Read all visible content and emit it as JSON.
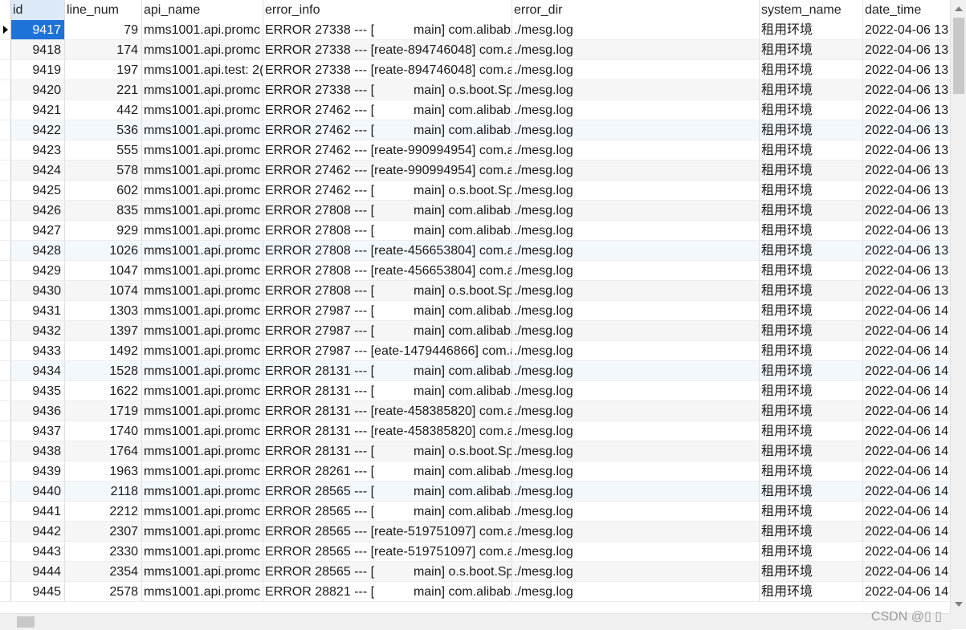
{
  "columns": [
    "id",
    "line_num",
    "api_name",
    "error_info",
    "error_dir",
    "system_name",
    "date_time"
  ],
  "rows": [
    {
      "id": "9417",
      "line_num": "79",
      "api_name": "mms1001.api.promc",
      "error_info": "ERROR 27338 --- [           main] com.alibaba",
      "error_dir": "./mesg.log",
      "system_name": "租用环境",
      "date_time": "2022-04-06 13"
    },
    {
      "id": "9418",
      "line_num": "174",
      "api_name": "mms1001.api.promc",
      "error_info": "ERROR 27338 --- [reate-894746048] com.a",
      "error_dir": "./mesg.log",
      "system_name": "租用环境",
      "date_time": "2022-04-06 13"
    },
    {
      "id": "9419",
      "line_num": "197",
      "api_name": "mms1001.api.test: 2(",
      "error_info": "ERROR 27338 --- [reate-894746048] com.a",
      "error_dir": "./mesg.log",
      "system_name": "租用环境",
      "date_time": "2022-04-06 13"
    },
    {
      "id": "9420",
      "line_num": "221",
      "api_name": "mms1001.api.promc",
      "error_info": "ERROR 27338 --- [           main] o.s.boot.Spr",
      "error_dir": "./mesg.log",
      "system_name": "租用环境",
      "date_time": "2022-04-06 13"
    },
    {
      "id": "9421",
      "line_num": "442",
      "api_name": "mms1001.api.promc",
      "error_info": "ERROR 27462 --- [           main] com.alibaba",
      "error_dir": "./mesg.log",
      "system_name": "租用环境",
      "date_time": "2022-04-06 13"
    },
    {
      "id": "9422",
      "line_num": "536",
      "api_name": "mms1001.api.promc",
      "error_info": "ERROR 27462 --- [           main] com.alibaba",
      "error_dir": "./mesg.log",
      "system_name": "租用环境",
      "date_time": "2022-04-06 13"
    },
    {
      "id": "9423",
      "line_num": "555",
      "api_name": "mms1001.api.promc",
      "error_info": "ERROR 27462 --- [reate-990994954] com.a",
      "error_dir": "./mesg.log",
      "system_name": "租用环境",
      "date_time": "2022-04-06 13"
    },
    {
      "id": "9424",
      "line_num": "578",
      "api_name": "mms1001.api.promc",
      "error_info": "ERROR 27462 --- [reate-990994954] com.a",
      "error_dir": "./mesg.log",
      "system_name": "租用环境",
      "date_time": "2022-04-06 13"
    },
    {
      "id": "9425",
      "line_num": "602",
      "api_name": "mms1001.api.promc",
      "error_info": "ERROR 27462 --- [           main] o.s.boot.Spr",
      "error_dir": "./mesg.log",
      "system_name": "租用环境",
      "date_time": "2022-04-06 13"
    },
    {
      "id": "9426",
      "line_num": "835",
      "api_name": "mms1001.api.promc",
      "error_info": "ERROR 27808 --- [           main] com.alibaba",
      "error_dir": "./mesg.log",
      "system_name": "租用环境",
      "date_time": "2022-04-06 13"
    },
    {
      "id": "9427",
      "line_num": "929",
      "api_name": "mms1001.api.promc",
      "error_info": "ERROR 27808 --- [           main] com.alibaba",
      "error_dir": "./mesg.log",
      "system_name": "租用环境",
      "date_time": "2022-04-06 13"
    },
    {
      "id": "9428",
      "line_num": "1026",
      "api_name": "mms1001.api.promc",
      "error_info": "ERROR 27808 --- [reate-456653804] com.a",
      "error_dir": "./mesg.log",
      "system_name": "租用环境",
      "date_time": "2022-04-06 13"
    },
    {
      "id": "9429",
      "line_num": "1047",
      "api_name": "mms1001.api.promc",
      "error_info": "ERROR 27808 --- [reate-456653804] com.a",
      "error_dir": "./mesg.log",
      "system_name": "租用环境",
      "date_time": "2022-04-06 13"
    },
    {
      "id": "9430",
      "line_num": "1074",
      "api_name": "mms1001.api.promc",
      "error_info": "ERROR 27808 --- [           main] o.s.boot.Spr",
      "error_dir": "./mesg.log",
      "system_name": "租用环境",
      "date_time": "2022-04-06 13"
    },
    {
      "id": "9431",
      "line_num": "1303",
      "api_name": "mms1001.api.promc",
      "error_info": "ERROR 27987 --- [           main] com.alibaba",
      "error_dir": "./mesg.log",
      "system_name": "租用环境",
      "date_time": "2022-04-06 14"
    },
    {
      "id": "9432",
      "line_num": "1397",
      "api_name": "mms1001.api.promc",
      "error_info": "ERROR 27987 --- [           main] com.alibaba",
      "error_dir": "./mesg.log",
      "system_name": "租用环境",
      "date_time": "2022-04-06 14"
    },
    {
      "id": "9433",
      "line_num": "1492",
      "api_name": "mms1001.api.promc",
      "error_info": "ERROR 27987 --- [eate-1479446866] com.a",
      "error_dir": "./mesg.log",
      "system_name": "租用环境",
      "date_time": "2022-04-06 14"
    },
    {
      "id": "9434",
      "line_num": "1528",
      "api_name": "mms1001.api.promc",
      "error_info": "ERROR 28131 --- [           main] com.alibaba",
      "error_dir": "./mesg.log",
      "system_name": "租用环境",
      "date_time": "2022-04-06 14"
    },
    {
      "id": "9435",
      "line_num": "1622",
      "api_name": "mms1001.api.promc",
      "error_info": "ERROR 28131 --- [           main] com.alibaba",
      "error_dir": "./mesg.log",
      "system_name": "租用环境",
      "date_time": "2022-04-06 14"
    },
    {
      "id": "9436",
      "line_num": "1719",
      "api_name": "mms1001.api.promc",
      "error_info": "ERROR 28131 --- [reate-458385820] com.a",
      "error_dir": "./mesg.log",
      "system_name": "租用环境",
      "date_time": "2022-04-06 14"
    },
    {
      "id": "9437",
      "line_num": "1740",
      "api_name": "mms1001.api.promc",
      "error_info": "ERROR 28131 --- [reate-458385820] com.a",
      "error_dir": "./mesg.log",
      "system_name": "租用环境",
      "date_time": "2022-04-06 14"
    },
    {
      "id": "9438",
      "line_num": "1764",
      "api_name": "mms1001.api.promc",
      "error_info": "ERROR 28131 --- [           main] o.s.boot.Spr",
      "error_dir": "./mesg.log",
      "system_name": "租用环境",
      "date_time": "2022-04-06 14"
    },
    {
      "id": "9439",
      "line_num": "1963",
      "api_name": "mms1001.api.promc",
      "error_info": "ERROR 28261 --- [           main] com.alibaba",
      "error_dir": "./mesg.log",
      "system_name": "租用环境",
      "date_time": "2022-04-06 14"
    },
    {
      "id": "9440",
      "line_num": "2118",
      "api_name": "mms1001.api.promc",
      "error_info": "ERROR 28565 --- [           main] com.alibaba",
      "error_dir": "./mesg.log",
      "system_name": "租用环境",
      "date_time": "2022-04-06 14"
    },
    {
      "id": "9441",
      "line_num": "2212",
      "api_name": "mms1001.api.promc",
      "error_info": "ERROR 28565 --- [           main] com.alibaba",
      "error_dir": "./mesg.log",
      "system_name": "租用环境",
      "date_time": "2022-04-06 14"
    },
    {
      "id": "9442",
      "line_num": "2307",
      "api_name": "mms1001.api.promc",
      "error_info": "ERROR 28565 --- [reate-519751097] com.a",
      "error_dir": "./mesg.log",
      "system_name": "租用环境",
      "date_time": "2022-04-06 14"
    },
    {
      "id": "9443",
      "line_num": "2330",
      "api_name": "mms1001.api.promc",
      "error_info": "ERROR 28565 --- [reate-519751097] com.a",
      "error_dir": "./mesg.log",
      "system_name": "租用环境",
      "date_time": "2022-04-06 14"
    },
    {
      "id": "9444",
      "line_num": "2354",
      "api_name": "mms1001.api.promc",
      "error_info": "ERROR 28565 --- [           main] o.s.boot.Spr",
      "error_dir": "./mesg.log",
      "system_name": "租用环境",
      "date_time": "2022-04-06 14"
    },
    {
      "id": "9445",
      "line_num": "2578",
      "api_name": "mms1001.api.promc",
      "error_info": "ERROR 28821 --- [           main] com.alibaba",
      "error_dir": "./mesg.log",
      "system_name": "租用环境",
      "date_time": "2022-04-06 14"
    }
  ],
  "watermark": "CSDN @▯ ▯",
  "colors": {
    "selection": "#1e73d8",
    "header_highlight": "#dce9f7",
    "row_hover": "#f3f8fd"
  },
  "icons": {
    "row_pointer": "record-pointer-icon",
    "scroll_up": "scroll-up-arrow-icon",
    "scroll_down": "scroll-down-arrow-icon"
  }
}
